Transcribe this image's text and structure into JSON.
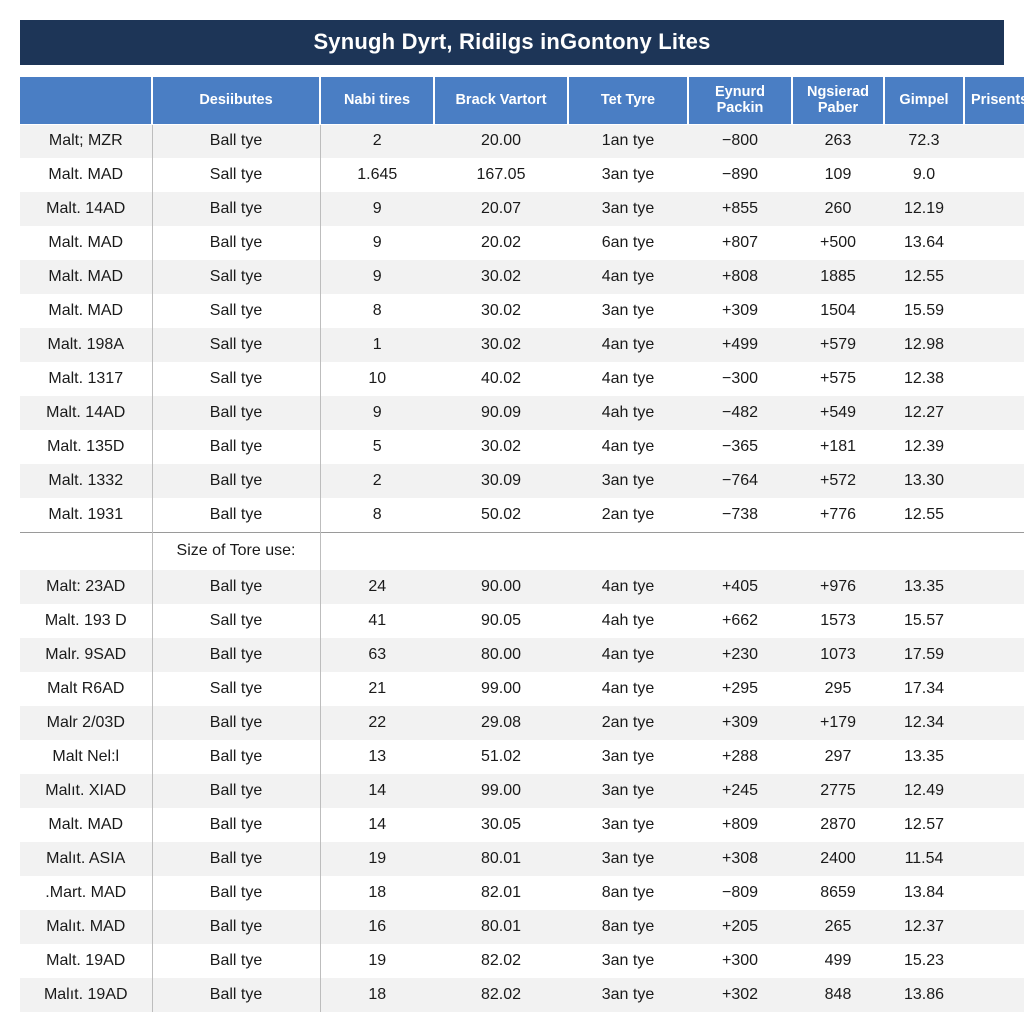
{
  "document": {
    "title": "Synugh Dyrt, Ridilgs inGontony Lites",
    "theme": {
      "title_bar_color": "#1d3557",
      "header_color": "#4a7ec4",
      "row_alt_color": "#f2f2f2",
      "row_plain_color": "#ffffff",
      "text_color": "#1a1a1a"
    }
  },
  "table": {
    "headers": [
      "",
      "Desiibutes",
      "Nabi tires",
      "Brack Vartort",
      "Tet Tyre",
      "Eynurd Packin",
      "Ngsierad Paber",
      "Gimpel",
      "Prisents"
    ],
    "section_note": "Size of Tore use:",
    "rows_top": [
      {
        "name": "Malt; MZR",
        "desc": "Ball tye",
        "nabi": "2",
        "brack": "20.00",
        "tet": "1an tye",
        "eynurd": "−800",
        "paber": "263",
        "gimpel": "72.3",
        "prisents": ""
      },
      {
        "name": "Malt. MAD",
        "desc": "Sall tye",
        "nabi": "1.645",
        "brack": "167.05",
        "tet": "3an tye",
        "eynurd": "−890",
        "paber": "109",
        "gimpel": "9.0",
        "prisents": ""
      },
      {
        "name": "Malt. 14AD",
        "desc": "Ball tye",
        "nabi": "9",
        "brack": "20.07",
        "tet": "3an tye",
        "eynurd": "+855",
        "paber": "260",
        "gimpel": "12.19",
        "prisents": ""
      },
      {
        "name": "Malt. MAD",
        "desc": "Ball tye",
        "nabi": "9",
        "brack": "20.02",
        "tet": "6an tye",
        "eynurd": "+807",
        "paber": "+500",
        "gimpel": "13.64",
        "prisents": ""
      },
      {
        "name": "Malt. MAD",
        "desc": "Sall tye",
        "nabi": "9",
        "brack": "30.02",
        "tet": "4an tye",
        "eynurd": "+808",
        "paber": "1885",
        "gimpel": "12.55",
        "prisents": ""
      },
      {
        "name": "Malt. MAD",
        "desc": "Sall tye",
        "nabi": "8",
        "brack": "30.02",
        "tet": "3an tye",
        "eynurd": "+309",
        "paber": "1504",
        "gimpel": "15.59",
        "prisents": ""
      },
      {
        "name": "Malt. 198A",
        "desc": "Sall tye",
        "nabi": "1",
        "brack": "30.02",
        "tet": "4an tye",
        "eynurd": "+499",
        "paber": "+579",
        "gimpel": "12.98",
        "prisents": ""
      },
      {
        "name": "Malt. 1317",
        "desc": "Sall tye",
        "nabi": "10",
        "brack": "40.02",
        "tet": "4an tye",
        "eynurd": "−300",
        "paber": "+575",
        "gimpel": "12.38",
        "prisents": ""
      },
      {
        "name": "Malt. 14AD",
        "desc": "Ball tye",
        "nabi": "9",
        "brack": "90.09",
        "tet": "4ah tye",
        "eynurd": "−482",
        "paber": "+549",
        "gimpel": "12.27",
        "prisents": ""
      },
      {
        "name": "Malt. 135D",
        "desc": "Ball tye",
        "nabi": "5",
        "brack": "30.02",
        "tet": "4an tye",
        "eynurd": "−365",
        "paber": "+181",
        "gimpel": "12.39",
        "prisents": ""
      },
      {
        "name": "Malt. 1332",
        "desc": "Ball tye",
        "nabi": "2",
        "brack": "30.09",
        "tet": "3an tye",
        "eynurd": "−764",
        "paber": "+572",
        "gimpel": "13.30",
        "prisents": ""
      },
      {
        "name": "Malt. 1931",
        "desc": "Ball tye",
        "nabi": "8",
        "brack": "50.02",
        "tet": "2an tye",
        "eynurd": "−738",
        "paber": "+776",
        "gimpel": "12.55",
        "prisents": ""
      }
    ],
    "rows_bottom": [
      {
        "name": "Malt: 23AD",
        "desc": "Ball tye",
        "nabi": "24",
        "brack": "90.00",
        "tet": "4an tye",
        "eynurd": "+405",
        "paber": "+976",
        "gimpel": "13.35",
        "prisents": ""
      },
      {
        "name": "Malt. 193 D",
        "desc": "Sall tye",
        "nabi": "41",
        "brack": "90.05",
        "tet": "4ah tye",
        "eynurd": "+662",
        "paber": "1573",
        "gimpel": "15.57",
        "prisents": ""
      },
      {
        "name": "Malr. 9SAD",
        "desc": "Ball tye",
        "nabi": "63",
        "brack": "80.00",
        "tet": "4an tye",
        "eynurd": "+230",
        "paber": "1073",
        "gimpel": "17.59",
        "prisents": ""
      },
      {
        "name": "Malt R6AD",
        "desc": "Sall tye",
        "nabi": "21",
        "brack": "99.00",
        "tet": "4an tye",
        "eynurd": "+295",
        "paber": "295",
        "gimpel": "17.34",
        "prisents": ""
      },
      {
        "name": "Malr 2/03D",
        "desc": "Ball tye",
        "nabi": "22",
        "brack": "29.08",
        "tet": "2an tye",
        "eynurd": "+309",
        "paber": "+179",
        "gimpel": "12.34",
        "prisents": ""
      },
      {
        "name": "Malt Nel:l",
        "desc": "Ball tye",
        "nabi": "13",
        "brack": "51.02",
        "tet": "3an tye",
        "eynurd": "+288",
        "paber": "297",
        "gimpel": "13.35",
        "prisents": ""
      },
      {
        "name": "Malıt. XIAD",
        "desc": "Ball tye",
        "nabi": "14",
        "brack": "99.00",
        "tet": "3an tye",
        "eynurd": "+245",
        "paber": "2775",
        "gimpel": "12.49",
        "prisents": ""
      },
      {
        "name": "Malt. MAD",
        "desc": "Ball tye",
        "nabi": "14",
        "brack": "30.05",
        "tet": "3an tye",
        "eynurd": "+809",
        "paber": "2870",
        "gimpel": "12.57",
        "prisents": ""
      },
      {
        "name": "Malıt. ASIA",
        "desc": "Ball tye",
        "nabi": "19",
        "brack": "80.01",
        "tet": "3an tye",
        "eynurd": "+308",
        "paber": "2400",
        "gimpel": "11.54",
        "prisents": ""
      },
      {
        "name": ".Mart. MAD",
        "desc": "Ball tye",
        "nabi": "18",
        "brack": "82.01",
        "tet": "8an tye",
        "eynurd": "−809",
        "paber": "8659",
        "gimpel": "13.84",
        "prisents": ""
      },
      {
        "name": "Malıt. MAD",
        "desc": "Ball tye",
        "nabi": "16",
        "brack": "80.01",
        "tet": "8an tye",
        "eynurd": "+205",
        "paber": "265",
        "gimpel": "12.37",
        "prisents": ""
      },
      {
        "name": "Malt. 19AD",
        "desc": "Ball tye",
        "nabi": "19",
        "brack": "82.02",
        "tet": "3an tye",
        "eynurd": "+300",
        "paber": "499",
        "gimpel": "15.23",
        "prisents": ""
      },
      {
        "name": "Malıt. 19AD",
        "desc": "Ball tye",
        "nabi": "18",
        "brack": "82.02",
        "tet": "3an tye",
        "eynurd": "+302",
        "paber": "848",
        "gimpel": "13.86",
        "prisents": ""
      }
    ]
  }
}
